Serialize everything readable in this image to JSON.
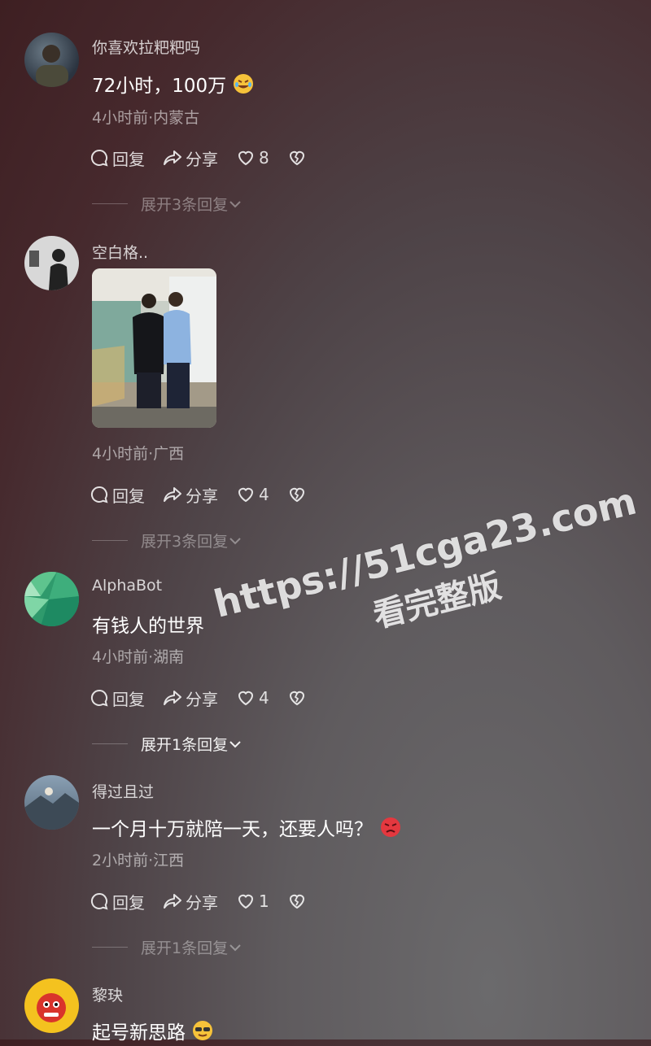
{
  "comments": [
    {
      "name": "你喜欢拉粑粑吗",
      "text": "72小时，100万",
      "emoji": "laughing-tears-emoji",
      "meta": "4小时前·内蒙古",
      "reply": "回复",
      "share": "分享",
      "likes": "8",
      "expand": "展开3条回复"
    },
    {
      "name": "空白格..",
      "meta": "4小时前·广西",
      "reply": "回复",
      "share": "分享",
      "likes": "4",
      "expand": "展开3条回复"
    },
    {
      "name": "AlphaBot",
      "text": "有钱人的世界",
      "meta": "4小时前·湖南",
      "reply": "回复",
      "share": "分享",
      "likes": "4",
      "expand": "展开1条回复"
    },
    {
      "name": "得过且过",
      "text": "一个月十万就陪一天，还要人吗？",
      "emoji": "angry-face-emoji",
      "meta": "2小时前·江西",
      "reply": "回复",
      "share": "分享",
      "likes": "1",
      "expand": "展开1条回复"
    },
    {
      "name": "黎玦",
      "text": "起号新思路",
      "emoji": "sunglasses-face-emoji"
    }
  ],
  "watermark": {
    "line1": "https://51cga23.com",
    "line2": "看完整版"
  },
  "colors": {
    "bg_top": "#3e1f22",
    "bg_bottom": "#6b6a6c",
    "text_primary": "#ffffff"
  }
}
